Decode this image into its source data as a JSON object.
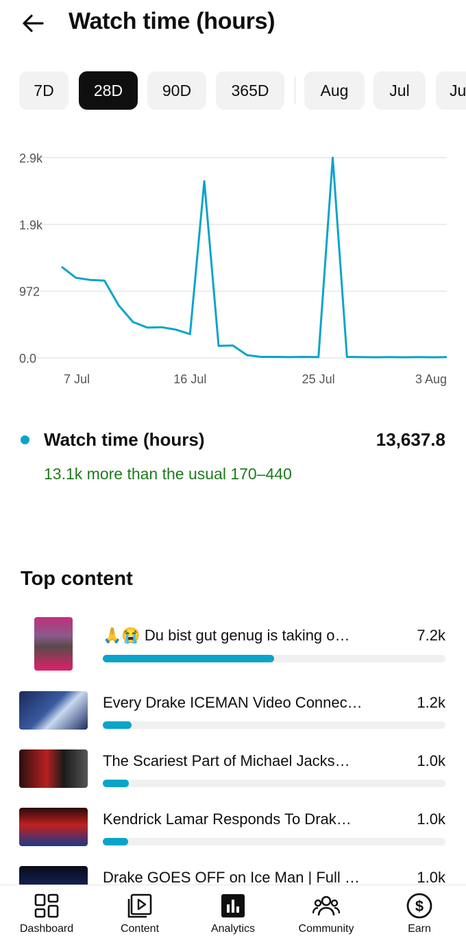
{
  "header": {
    "title": "Watch time (hours)"
  },
  "chips": [
    {
      "label": "7D",
      "active": false
    },
    {
      "label": "28D",
      "active": true
    },
    {
      "label": "90D",
      "active": false
    },
    {
      "label": "365D",
      "active": false
    },
    {
      "label": "Aug",
      "active": false
    },
    {
      "label": "Jul",
      "active": false
    },
    {
      "label": "Ju",
      "active": false
    }
  ],
  "chart_data": {
    "type": "line",
    "y_ticks": [
      "2.9k",
      "1.9k",
      "972",
      "0.0"
    ],
    "x_ticks": [
      "7 Jul",
      "16 Jul",
      "25 Jul",
      "3 Aug"
    ],
    "ylim": [
      0,
      2900
    ],
    "color": "#0aa4c9",
    "x": [
      "7 Jul",
      "8 Jul",
      "9 Jul",
      "10 Jul",
      "11 Jul",
      "12 Jul",
      "13 Jul",
      "14 Jul",
      "15 Jul",
      "16 Jul",
      "17 Jul",
      "18 Jul",
      "19 Jul",
      "20 Jul",
      "21 Jul",
      "22 Jul",
      "23 Jul",
      "24 Jul",
      "25 Jul",
      "26 Jul",
      "27 Jul",
      "28 Jul",
      "29 Jul",
      "30 Jul",
      "31 Jul",
      "1 Aug",
      "2 Aug",
      "3 Aug"
    ],
    "series": [
      {
        "values": [
          1320,
          1160,
          1130,
          1120,
          760,
          520,
          440,
          445,
          410,
          345,
          2560,
          175,
          180,
          40,
          15,
          15,
          12,
          15,
          12,
          2900,
          15,
          12,
          10,
          12,
          10,
          12,
          10,
          12
        ]
      }
    ]
  },
  "metric": {
    "label": "Watch time (hours)",
    "value": "13,637.8",
    "note": "13.1k more than the usual 170–440"
  },
  "top_content": {
    "title": "Top content",
    "items": [
      {
        "title": "🙏😭 Du bist gut genug is taking o…",
        "value": "7.2k",
        "share": 0.5
      },
      {
        "title": "Every Drake ICEMAN Video Connec…",
        "value": "1.2k",
        "share": 0.083
      },
      {
        "title": "The Scariest Part of Michael Jacks…",
        "value": "1.0k",
        "share": 0.076
      },
      {
        "title": "Kendrick Lamar Responds To Drak…",
        "value": "1.0k",
        "share": 0.073
      },
      {
        "title": "Drake GOES OFF on Ice Man | Full …",
        "value": "1.0k",
        "share": 0.07
      }
    ]
  },
  "nav": [
    {
      "label": "Dashboard",
      "icon": "dashboard-icon"
    },
    {
      "label": "Content",
      "icon": "content-icon"
    },
    {
      "label": "Analytics",
      "icon": "analytics-icon"
    },
    {
      "label": "Community",
      "icon": "community-icon"
    },
    {
      "label": "Earn",
      "icon": "earn-icon"
    }
  ]
}
